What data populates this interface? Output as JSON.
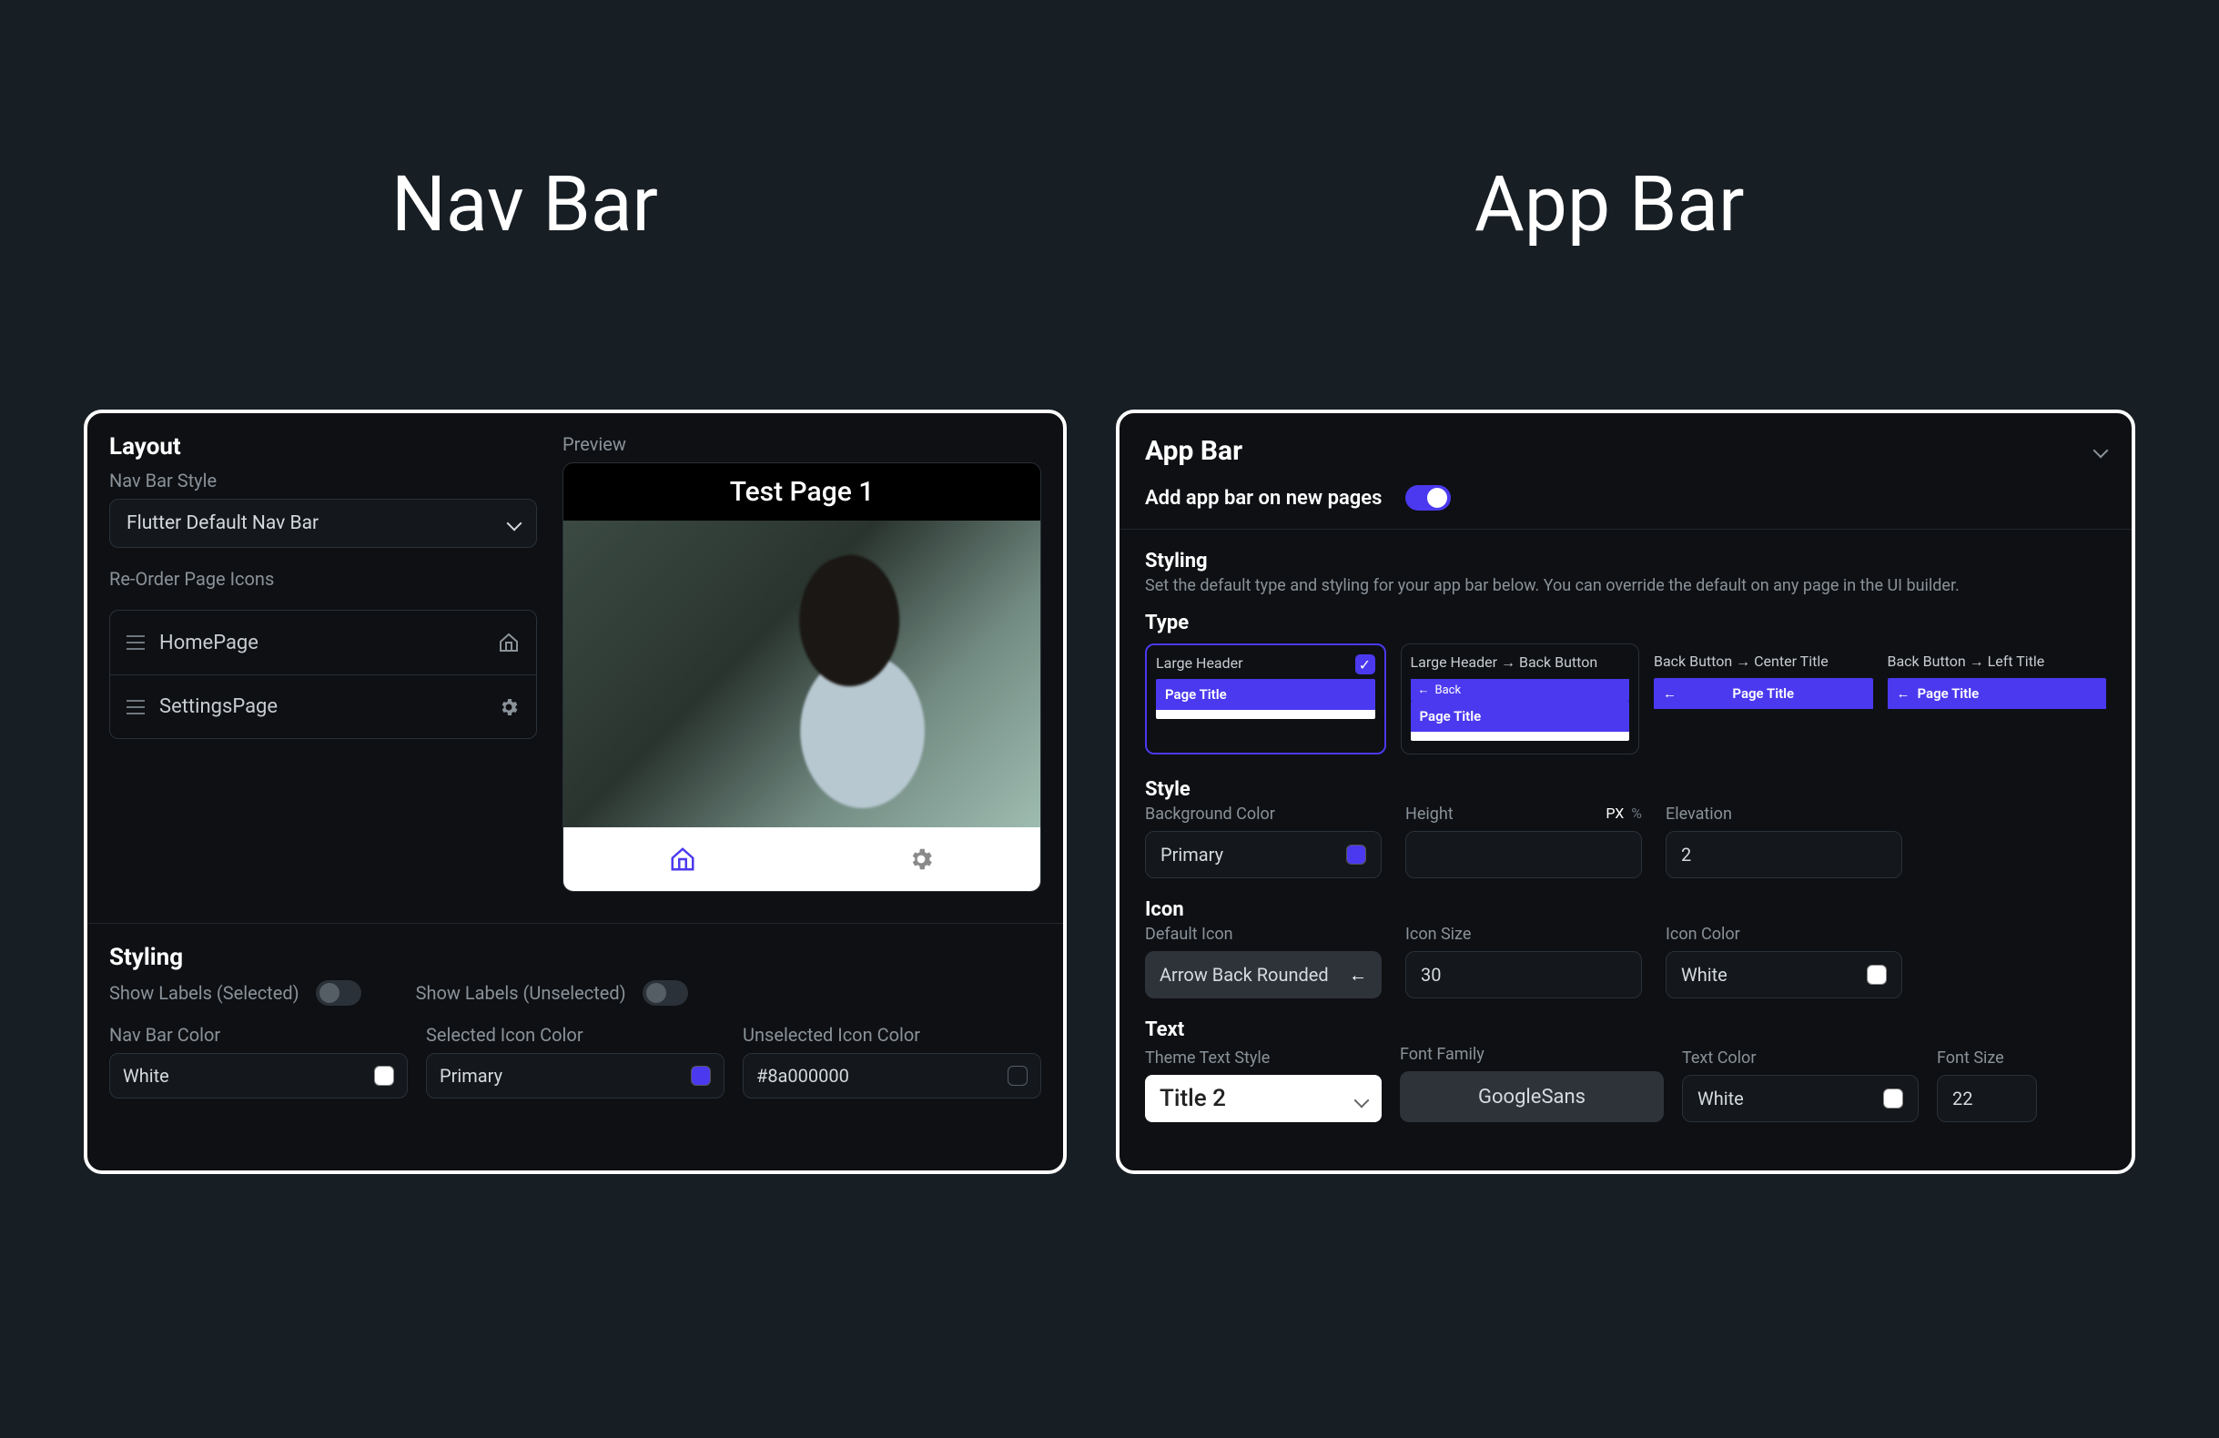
{
  "headings": {
    "left": "Nav Bar",
    "right": "App Bar"
  },
  "navbar": {
    "layout": {
      "title": "Layout",
      "style_label": "Nav Bar Style",
      "style_value": "Flutter Default Nav Bar",
      "reorder_label": "Re-Order Page Icons",
      "pages": [
        {
          "name": "HomePage",
          "icon": "home"
        },
        {
          "name": "SettingsPage",
          "icon": "gear"
        }
      ]
    },
    "preview": {
      "label": "Preview",
      "title": "Test Page 1"
    },
    "styling": {
      "title": "Styling",
      "show_labels_selected": {
        "label": "Show Labels (Selected)",
        "on": false
      },
      "show_labels_unselected": {
        "label": "Show Labels (Unselected)",
        "on": false
      },
      "colors": {
        "nav_bar": {
          "label": "Nav Bar Color",
          "value": "White",
          "swatch": "#ffffff"
        },
        "selected_icon": {
          "label": "Selected Icon Color",
          "value": "Primary",
          "swatch": "#4b39ef"
        },
        "unselected_icon": {
          "label": "Unselected Icon Color",
          "value": "#8a000000",
          "swatch": "transparent"
        }
      }
    }
  },
  "appbar": {
    "title": "App Bar",
    "add_on_new": {
      "label": "Add app bar on new pages",
      "on": true
    },
    "styling": {
      "title": "Styling",
      "desc": "Set the default type and styling for your app bar below. You can override the default on any page in the UI builder.",
      "type_label": "Type",
      "types": [
        {
          "label": "Large Header",
          "selected": true,
          "preview": "large"
        },
        {
          "label": "Large Header → Back Button",
          "selected": false,
          "preview": "large_back"
        },
        {
          "label": "Back Button → Center Title",
          "selected": false,
          "preview": "back_center"
        },
        {
          "label": "Back Button → Left Title",
          "selected": false,
          "preview": "back_left"
        }
      ],
      "preview_title": "Page Title",
      "preview_back": "Back",
      "style": {
        "heading": "Style",
        "bg_color": {
          "label": "Background Color",
          "value": "Primary",
          "swatch": "#4b39ef"
        },
        "height": {
          "label": "Height",
          "value": "",
          "unit": "PX",
          "alt_unit": "%"
        },
        "elevation": {
          "label": "Elevation",
          "value": "2"
        }
      },
      "icon": {
        "heading": "Icon",
        "default_icon": {
          "label": "Default Icon",
          "value": "Arrow Back Rounded"
        },
        "icon_size": {
          "label": "Icon Size",
          "value": "30"
        },
        "icon_color": {
          "label": "Icon Color",
          "value": "White",
          "swatch": "#ffffff"
        }
      },
      "text": {
        "heading": "Text",
        "theme_style": {
          "label": "Theme Text Style",
          "value": "Title 2"
        },
        "font_family": {
          "label": "Font Family",
          "value": "GoogleSans"
        },
        "text_color": {
          "label": "Text Color",
          "value": "White",
          "swatch": "#ffffff"
        },
        "font_size": {
          "label": "Font Size",
          "value": "22"
        }
      }
    }
  }
}
